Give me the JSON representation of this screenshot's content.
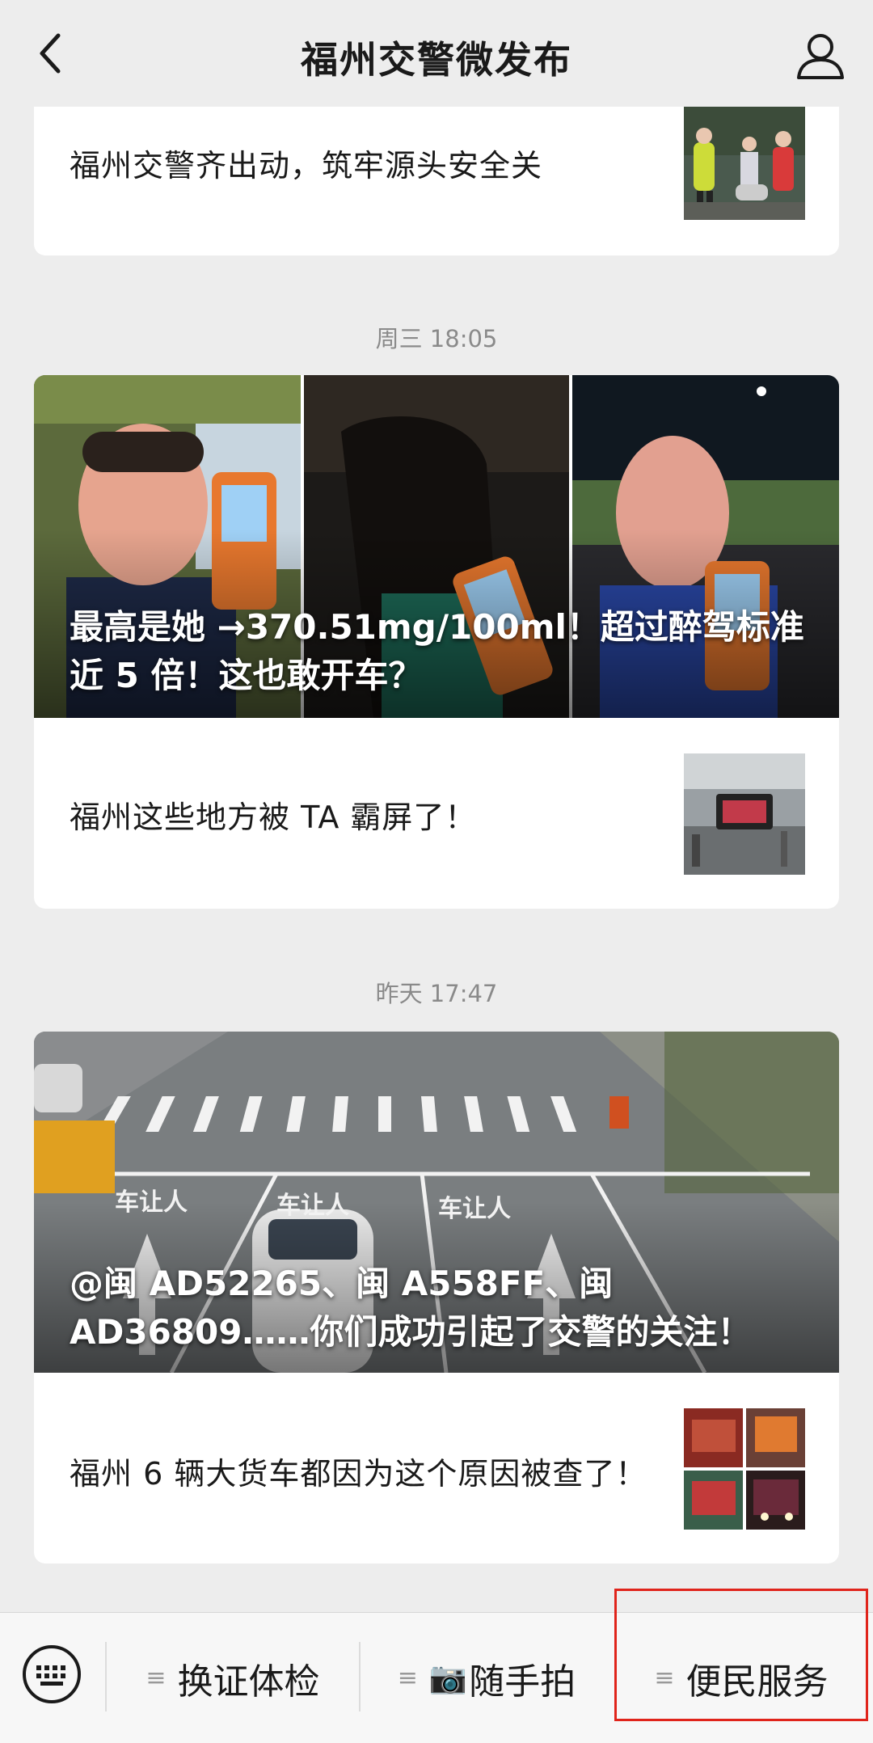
{
  "header": {
    "title": "福州交警微发布"
  },
  "articles": {
    "card1": {
      "title": "福州交警齐出动，筑牢源头安全关"
    },
    "group2": {
      "timestamp": "周三 18:05",
      "cover_title": "最高是她 →370.51mg/100ml！超过醉驾标准近 5 倍！这也敢开车？",
      "item_title": "福州这些地方被 TA 霸屏了！"
    },
    "group3": {
      "timestamp": "昨天 17:47",
      "cover_title": "@闽 AD52265、闽 A558FF、闽 AD36809……你们成功引起了交警的关注！",
      "road_markings": [
        "车让人",
        "车让人",
        "车让人"
      ],
      "item_title": "福州 6 辆大货车都因为这个原因被查了！"
    }
  },
  "bottom_menu": {
    "items": [
      {
        "label": "换证体检",
        "icon": ""
      },
      {
        "label": "随手拍",
        "icon": "📷"
      },
      {
        "label": "便民服务",
        "icon": ""
      }
    ],
    "menu_glyph": "≡",
    "highlight_color": "#e0241b"
  }
}
